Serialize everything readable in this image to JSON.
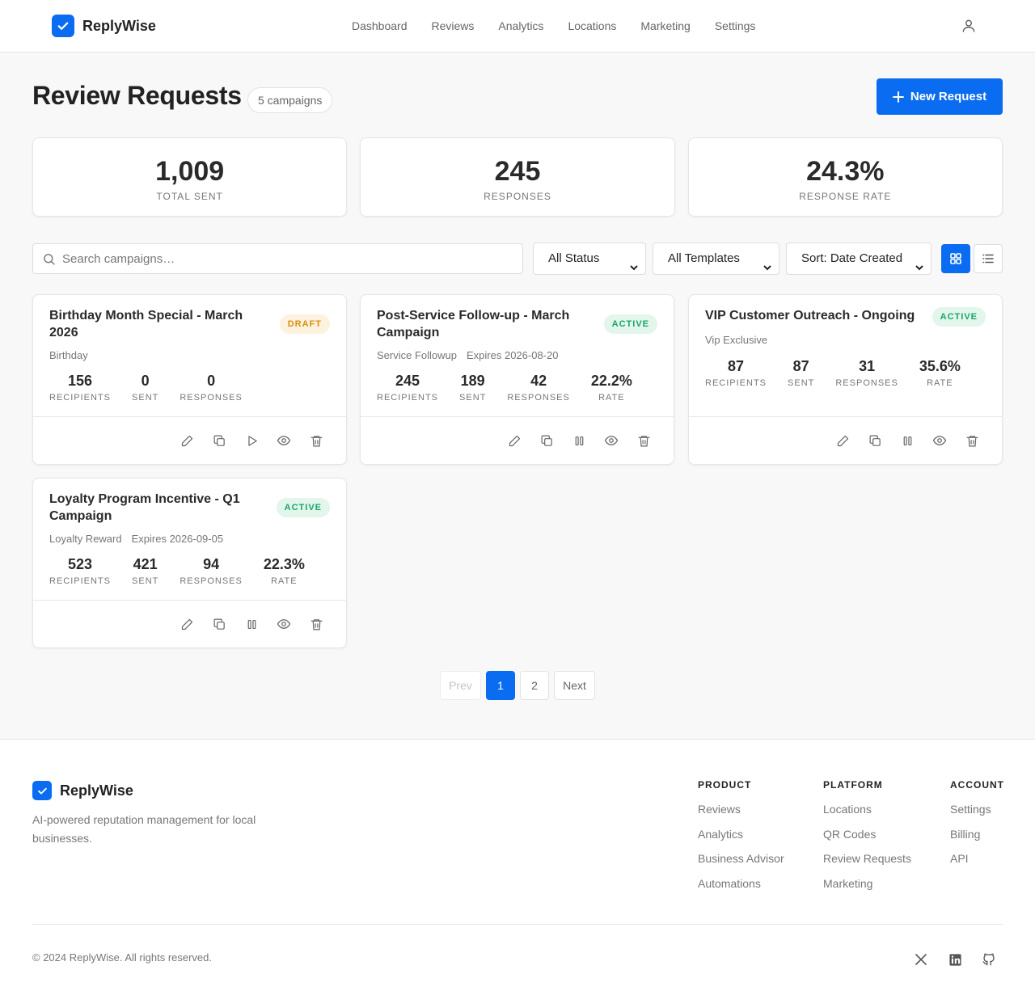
{
  "app": {
    "name": "ReplyWise"
  },
  "nav": {
    "items": [
      "Dashboard",
      "Reviews",
      "Analytics",
      "Locations",
      "Marketing",
      "Settings"
    ]
  },
  "page": {
    "title": "Review Requests",
    "campaign_count": "5 campaigns",
    "new_button": "New Request"
  },
  "stats": [
    {
      "value": "1,009",
      "label": "TOTAL SENT"
    },
    {
      "value": "245",
      "label": "RESPONSES"
    },
    {
      "value": "24.3%",
      "label": "RESPONSE RATE"
    }
  ],
  "toolbar": {
    "search_placeholder": "Search campaigns…",
    "status_filter": "All Status",
    "template_filter": "All Templates",
    "sort": "Sort: Date Created",
    "view_mode": "grid"
  },
  "campaigns": [
    {
      "title": "Birthday Month Special - March 2026",
      "status": "DRAFT",
      "template": "Birthday",
      "expires": "",
      "metrics": [
        {
          "value": "156",
          "label": "RECIPIENTS"
        },
        {
          "value": "0",
          "label": "SENT"
        },
        {
          "value": "0",
          "label": "RESPONSES"
        }
      ]
    },
    {
      "title": "Post-Service Follow-up - March Campaign",
      "status": "ACTIVE",
      "template": "Service Followup",
      "expires": "Expires 2026-08-20",
      "metrics": [
        {
          "value": "245",
          "label": "RECIPIENTS"
        },
        {
          "value": "189",
          "label": "SENT"
        },
        {
          "value": "42",
          "label": "RESPONSES"
        },
        {
          "value": "22.2%",
          "label": "RATE"
        }
      ]
    },
    {
      "title": "VIP Customer Outreach - Ongoing",
      "status": "ACTIVE",
      "template": "Vip Exclusive",
      "expires": "",
      "metrics": [
        {
          "value": "87",
          "label": "RECIPIENTS"
        },
        {
          "value": "87",
          "label": "SENT"
        },
        {
          "value": "31",
          "label": "RESPONSES"
        },
        {
          "value": "35.6%",
          "label": "RATE"
        }
      ]
    },
    {
      "title": "Loyalty Program Incentive - Q1 Campaign",
      "status": "ACTIVE",
      "template": "Loyalty Reward",
      "expires": "Expires 2026-09-05",
      "metrics": [
        {
          "value": "523",
          "label": "RECIPIENTS"
        },
        {
          "value": "421",
          "label": "SENT"
        },
        {
          "value": "94",
          "label": "RESPONSES"
        },
        {
          "value": "22.3%",
          "label": "RATE"
        }
      ]
    }
  ],
  "pagination": {
    "prev": "Prev",
    "pages": [
      "1",
      "2"
    ],
    "current": "1",
    "next": "Next"
  },
  "footer": {
    "tagline": "AI-powered reputation management for local businesses.",
    "columns": [
      {
        "heading": "PRODUCT",
        "links": [
          "Reviews",
          "Analytics",
          "Business Advisor",
          "Automations"
        ]
      },
      {
        "heading": "PLATFORM",
        "links": [
          "Locations",
          "QR Codes",
          "Review Requests",
          "Marketing"
        ]
      },
      {
        "heading": "ACCOUNT",
        "links": [
          "Settings",
          "Billing",
          "API"
        ]
      }
    ],
    "copyright": "© 2024 ReplyWise. All rights reserved.",
    "social": [
      "x-icon",
      "linkedin-icon",
      "github-icon"
    ]
  },
  "colors": {
    "accent": "#0a6cf0",
    "draft_badge": "#d98f12",
    "active_badge": "#1aa56b"
  }
}
